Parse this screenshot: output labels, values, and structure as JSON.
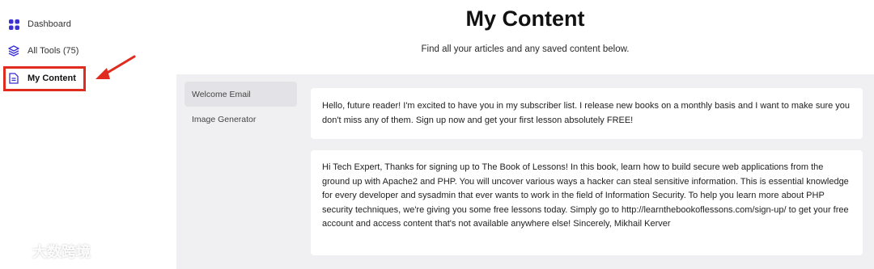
{
  "sidebar": {
    "items": [
      {
        "label": "Dashboard",
        "icon": "grid-icon"
      },
      {
        "label": "All Tools (75)",
        "icon": "layers-icon"
      },
      {
        "label": "My Content",
        "icon": "document-icon"
      }
    ]
  },
  "header": {
    "title": "My Content",
    "subtitle": "Find all your articles and any saved content below."
  },
  "tabs": [
    {
      "label": "Welcome Email",
      "active": true
    },
    {
      "label": "Image Generator",
      "active": false
    }
  ],
  "cards": [
    {
      "text": "Hello, future reader! I'm excited to have you in my subscriber list. I release new books on a monthly basis and I want to make sure you don't miss any of them. Sign up now and get your first lesson absolutely FREE!"
    },
    {
      "text": "Hi Tech Expert, Thanks for signing up to The Book of Lessons! In this book, learn how to build secure web applications from the ground up with Apache2 and PHP. You will uncover various ways a hacker can steal sensitive information. This is essential knowledge for every developer and sysadmin that ever wants to work in the field of Information Security. To help you learn more about PHP security techniques, we're giving you some free lessons today. Simply go to http://learnthebookoflessons.com/sign-up/ to get your free account and access content that's not available anywhere else! Sincerely, Mikhail Kerver"
    }
  ],
  "watermark": {
    "text": "大数跨境"
  },
  "colors": {
    "accent": "#3b2fd6",
    "highlight": "#e02b1f",
    "panel_bg": "#f0f0f2"
  }
}
